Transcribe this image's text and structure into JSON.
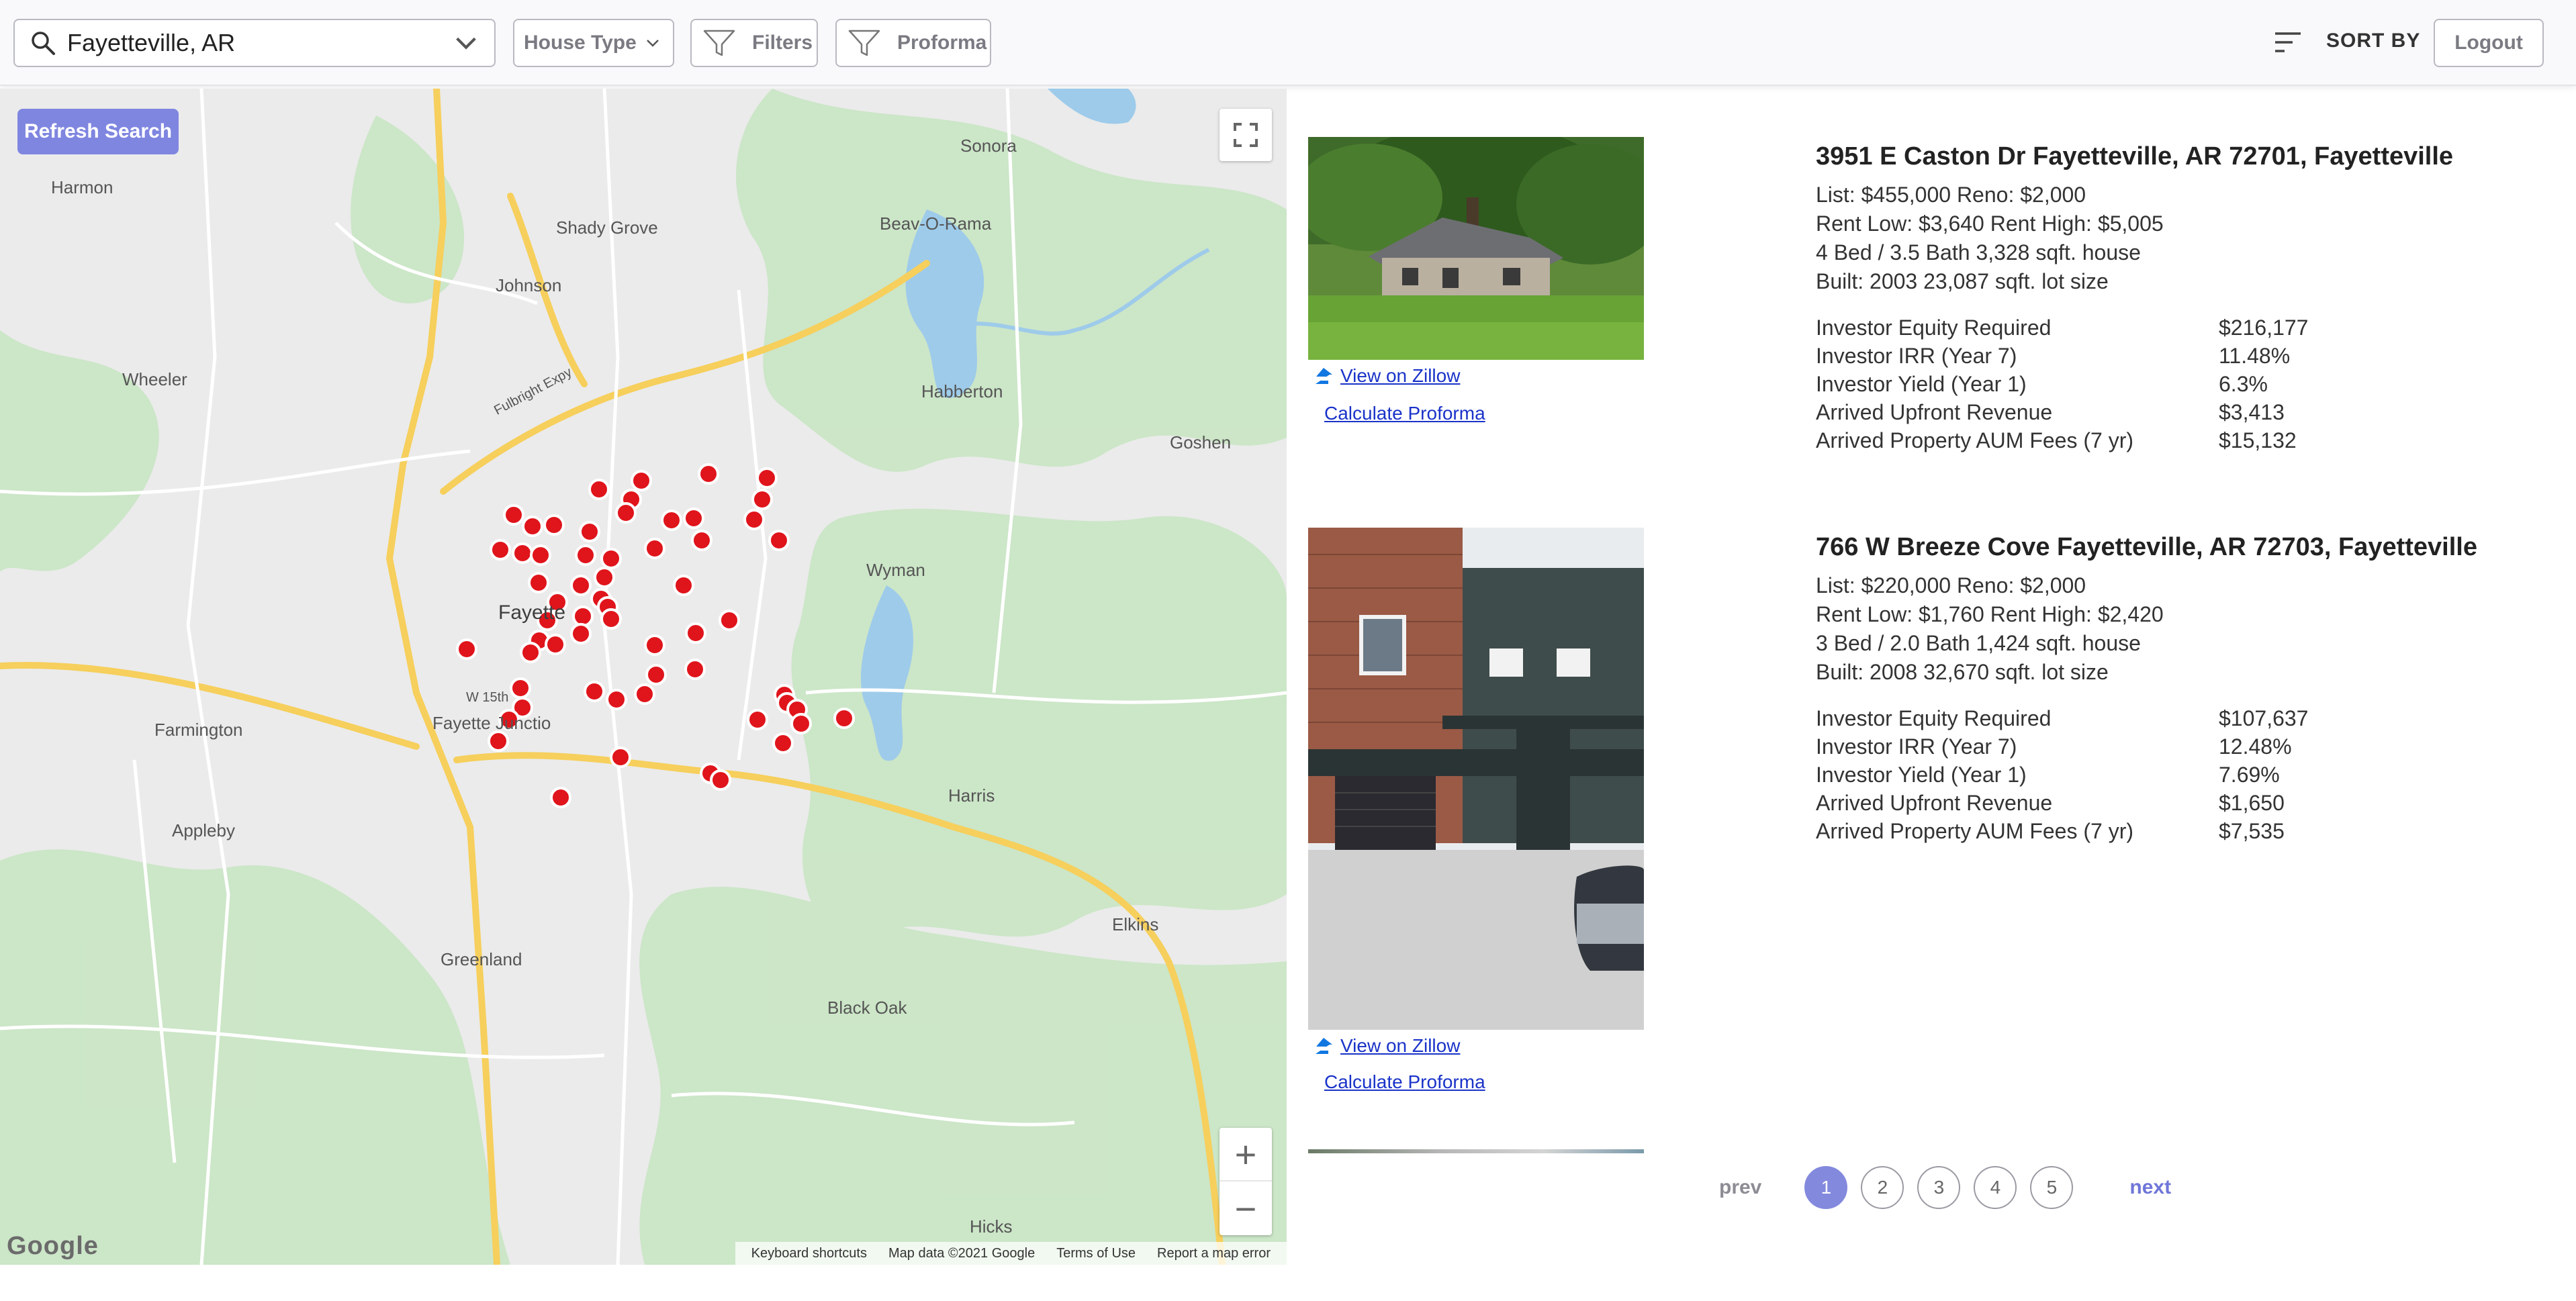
{
  "topbar": {
    "search_value": "Fayetteville, AR",
    "house_type_label": "House Type",
    "filters_label": "Filters",
    "proforma_label": "Proforma",
    "sort_label": "SORT BY",
    "logout_label": "Logout"
  },
  "map": {
    "refresh_label": "Refresh Search",
    "google_logo": "Google",
    "footer": {
      "shortcuts": "Keyboard shortcuts",
      "data": "Map data ©2021 Google",
      "terms": "Terms of Use",
      "report": "Report a map error"
    },
    "places": {
      "harmon": "Harmon",
      "shady_grove": "Shady Grove",
      "johnson": "Johnson",
      "wheeler": "Wheeler",
      "beav_o_rama": "Beav-O-Rama",
      "sonora": "Sonora",
      "habberton": "Habberton",
      "goshen": "Goshen",
      "wyman": "Wyman",
      "farmington": "Farmington",
      "fayetteville": "Fayette",
      "fayette_junction": "Fayette Junctio",
      "appleby": "Appleby",
      "harris": "Harris",
      "elkins": "Elkins",
      "greenland": "Greenland",
      "black_oak": "Black Oak",
      "hicks": "Hicks",
      "w15th": "W 15th",
      "fulbright": "Fulbright Expy"
    },
    "zoom_in": "+",
    "zoom_out": "−"
  },
  "listings": [
    {
      "address": "3951 E Caston Dr Fayetteville, AR 72701, Fayetteville",
      "price_line": "List: $455,000   Reno: $2,000",
      "rent_line": "Rent Low: $3,640  Rent High: $5,005",
      "beds_line": "4 Bed / 3.5 Bath  3,328 sqft. house",
      "built_line": "Built: 2003  23,087 sqft. lot size",
      "metrics": [
        {
          "label": "Investor Equity Required",
          "value": "$216,177"
        },
        {
          "label": "Investor IRR (Year 7)",
          "value": "11.48%"
        },
        {
          "label": "Investor Yield (Year 1)",
          "value": "6.3%"
        },
        {
          "label": "Arrived Upfront Revenue",
          "value": "$3,413"
        },
        {
          "label": "Arrived Property AUM Fees (7 yr)",
          "value": "$15,132"
        }
      ],
      "zillow_label": "View on Zillow",
      "proforma_label": "Calculate Proforma"
    },
    {
      "address": "766 W Breeze Cove Fayetteville, AR 72703, Fayetteville",
      "price_line": "List: $220,000   Reno: $2,000",
      "rent_line": "Rent Low: $1,760  Rent High: $2,420",
      "beds_line": "3 Bed / 2.0 Bath  1,424 sqft. house",
      "built_line": "Built: 2008  32,670 sqft. lot size",
      "metrics": [
        {
          "label": "Investor Equity Required",
          "value": "$107,637"
        },
        {
          "label": "Investor IRR (Year 7)",
          "value": "12.48%"
        },
        {
          "label": "Investor Yield (Year 1)",
          "value": "7.69%"
        },
        {
          "label": "Arrived Upfront Revenue",
          "value": "$1,650"
        },
        {
          "label": "Arrived Property AUM Fees (7 yr)",
          "value": "$7,535"
        }
      ],
      "zillow_label": "View on Zillow",
      "proforma_label": "Calculate Proforma"
    }
  ],
  "pagination": {
    "prev": "prev",
    "next": "next",
    "pages": [
      "1",
      "2",
      "3",
      "4",
      "5"
    ],
    "current": "1"
  },
  "colors": {
    "accent": "#8389dd",
    "marker": "#e0141b",
    "link": "#1a33c9"
  }
}
